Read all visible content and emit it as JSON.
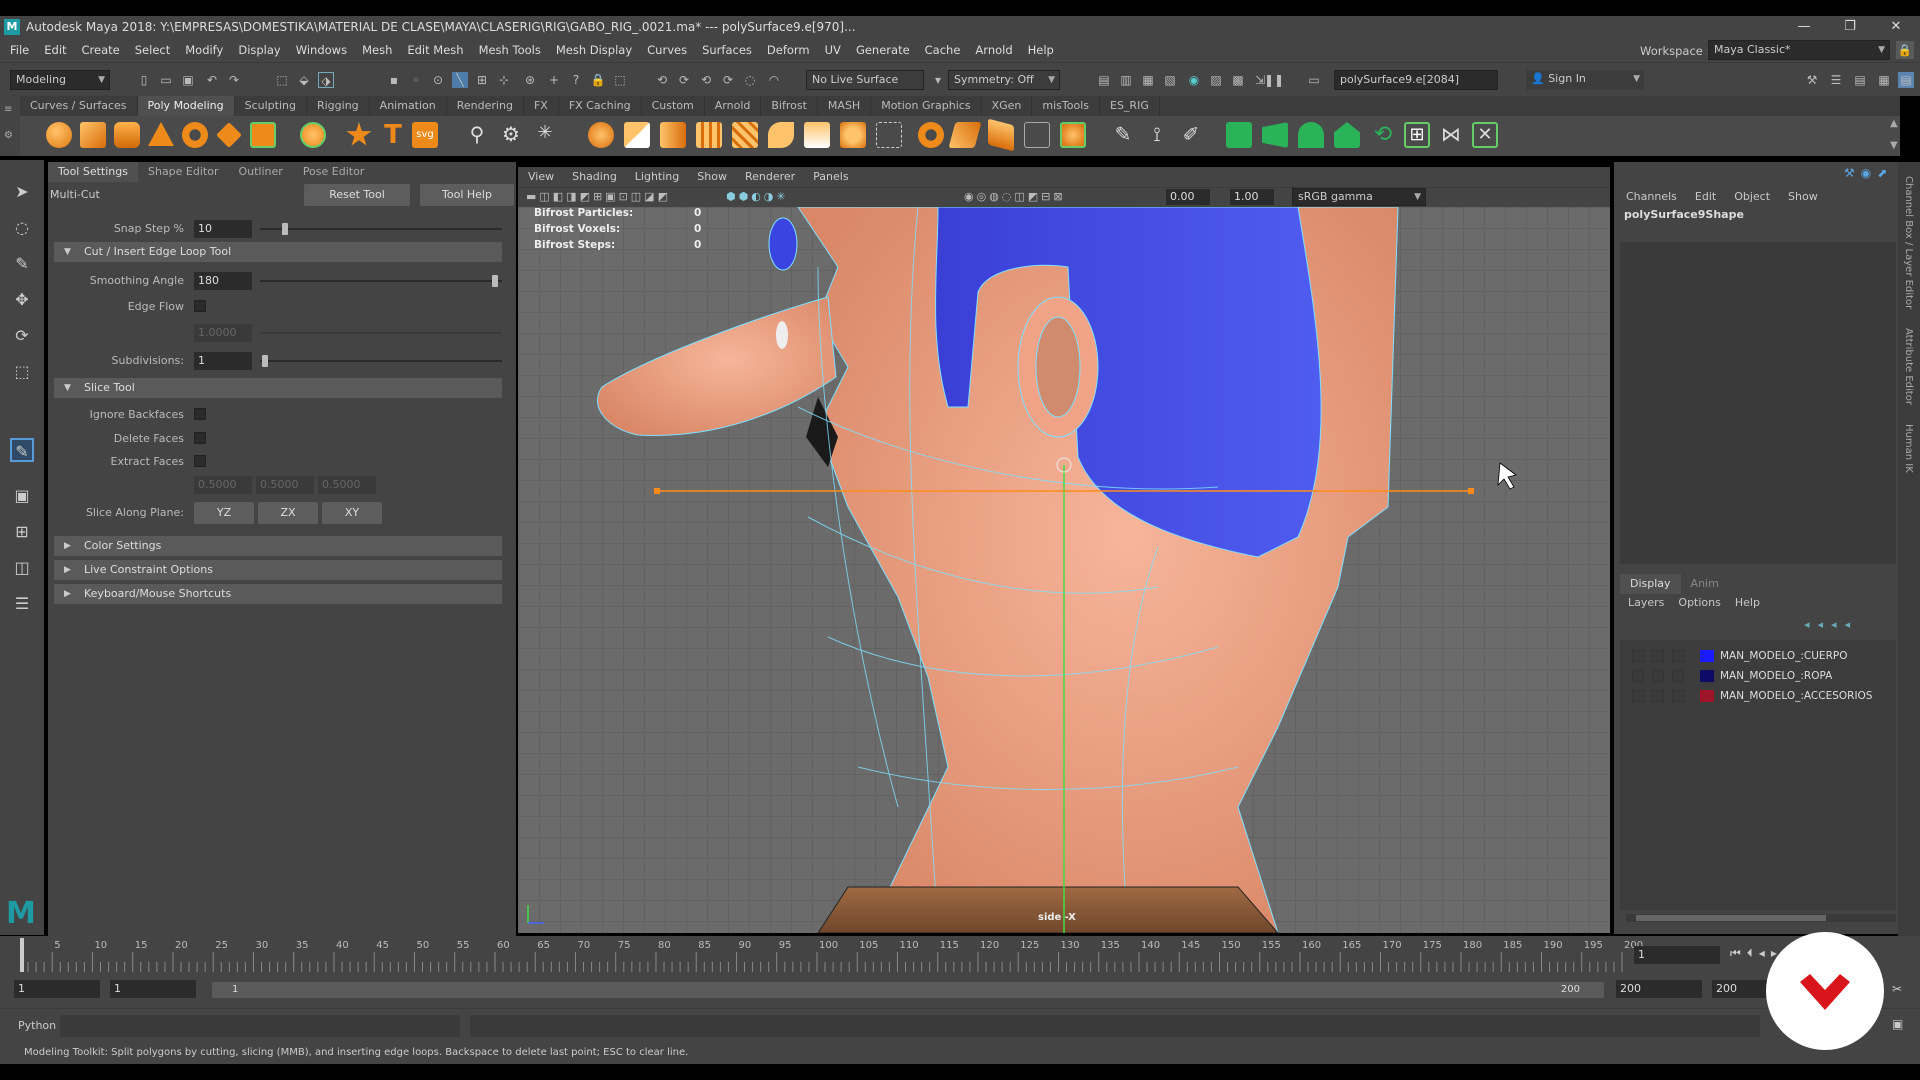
{
  "window": {
    "title": "Autodesk Maya 2018: Y:\\EMPRESAS\\DOMESTIKA\\MATERIAL DE CLASE\\MAYA\\CLASERIG\\RIG\\GABO_RIG_.0021.ma*   ---   polySurface9.e[970]...",
    "logo": "M",
    "controls": [
      "—",
      "❐",
      "✕"
    ]
  },
  "menubar": {
    "items": [
      "File",
      "Edit",
      "Create",
      "Select",
      "Modify",
      "Display",
      "Windows",
      "Mesh",
      "Edit Mesh",
      "Mesh Tools",
      "Mesh Display",
      "Curves",
      "Surfaces",
      "Deform",
      "UV",
      "Generate",
      "Cache",
      "Arnold",
      "Help"
    ],
    "workspace_label": "Workspace :",
    "workspace_value": "Maya Classic*"
  },
  "statusline": {
    "mode": "Modeling",
    "live_surface": "No Live Surface",
    "symmetry": "Symmetry: Off",
    "selection_field": "polySurface9.e[2084]",
    "sign_in": "Sign In"
  },
  "shelf": {
    "tabs": [
      "Curves / Surfaces",
      "Poly Modeling",
      "Sculpting",
      "Rigging",
      "Animation",
      "Rendering",
      "FX",
      "FX Caching",
      "Custom",
      "Arnold",
      "Bifrost",
      "MASH",
      "Motion Graphics",
      "XGen",
      "misTools",
      "ES_RIG"
    ],
    "active_tab": 1
  },
  "tool_settings": {
    "tabs": [
      "Tool Settings",
      "Shape Editor",
      "Outliner",
      "Pose Editor"
    ],
    "tool_name": "Multi-Cut",
    "reset_button": "Reset Tool",
    "help_button": "Tool Help",
    "snap_step_label": "Snap Step %",
    "snap_step_value": "10",
    "section_cut": "Cut / Insert Edge Loop Tool",
    "smoothing_angle_label": "Smoothing Angle",
    "smoothing_angle_value": "180",
    "edge_flow_label": "Edge Flow",
    "edge_flow_value": "1.0000",
    "subdivisions_label": "Subdivisions:",
    "subdivisions_value": "1",
    "section_slice": "Slice Tool",
    "ignore_backfaces_label": "Ignore Backfaces",
    "delete_faces_label": "Delete Faces",
    "extract_faces_label": "Extract Faces",
    "extract_values": [
      "0.5000",
      "0.5000",
      "0.5000"
    ],
    "slice_plane_label": "Slice Along Plane:",
    "slice_plane_buttons": [
      "YZ",
      "ZX",
      "XY"
    ],
    "section_color": "Color Settings",
    "section_live": "Live Constraint Options",
    "section_keyboard": "Keyboard/Mouse Shortcuts"
  },
  "viewport": {
    "menu": [
      "View",
      "Shading",
      "Lighting",
      "Show",
      "Renderer",
      "Panels"
    ],
    "exposure": "0.00",
    "gamma": "1.00",
    "colorspace": "sRGB gamma",
    "hud": [
      {
        "label": "Bifrost Particles:",
        "value": "0"
      },
      {
        "label": "Bifrost Voxels:",
        "value": "0"
      },
      {
        "label": "Bifrost Steps:",
        "value": "0"
      }
    ],
    "camera_label": "side -X"
  },
  "channel_box": {
    "menu": [
      "Channels",
      "Edit",
      "Object",
      "Show"
    ],
    "object_name": "polySurface9Shape"
  },
  "side_tabs": [
    "Channel Box / Layer Editor",
    "Attribute Editor",
    "Human IK"
  ],
  "layer_editor": {
    "tabs": [
      "Display",
      "Anim"
    ],
    "menu": [
      "Layers",
      "Options",
      "Help"
    ],
    "layers": [
      {
        "name": "MAN_MODELO_:CUERPO",
        "color": "#1a1aff"
      },
      {
        "name": "MAN_MODELO_:ROPA",
        "color": "#0c0c66"
      },
      {
        "name": "MAN_MODELO_:ACCESORIOS",
        "color": "#a0142a"
      }
    ]
  },
  "timeline": {
    "ticks": [
      "5",
      "10",
      "15",
      "20",
      "25",
      "30",
      "35",
      "40",
      "45",
      "50",
      "55",
      "60",
      "65",
      "70",
      "75",
      "80",
      "85",
      "90",
      "95",
      "100",
      "105",
      "110",
      "115",
      "120",
      "125",
      "130",
      "135",
      "140",
      "145",
      "150",
      "155",
      "160",
      "165",
      "170",
      "175",
      "180",
      "185",
      "190",
      "195",
      "200"
    ],
    "current_frame": "1",
    "range_start": "1",
    "range_start_inner": "1",
    "range_slider_start": "1",
    "range_slider_end": "200",
    "range_end": "200",
    "range_end_outer": "200"
  },
  "command_line": {
    "language": "Python"
  },
  "help_line": {
    "text": "Modeling Toolkit: Split polygons by cutting, slicing (MMB), and inserting edge loops. Backspace to delete last point; ESC to clear line."
  },
  "colors": {
    "hair": "#4a55e8",
    "skin": "#f0a386",
    "wire": "#7fe0ff",
    "slice_line": "#ff8c1a",
    "brand": "#d8151b"
  }
}
